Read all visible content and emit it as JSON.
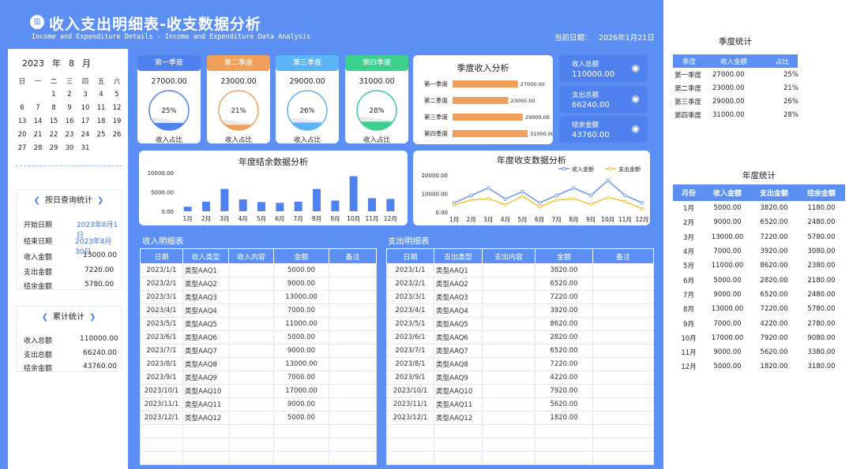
{
  "header": {
    "icon": "chart-badge-icon",
    "title": "收入支出明细表-收支数据分析",
    "subtitle": "Income and Expenditure Details - Income and Expenditure Data Analysis",
    "date_label": "当前日期：",
    "date_value": "2026年1月21日"
  },
  "calendar": {
    "year": "2023",
    "year_unit": "年",
    "month": "8",
    "month_unit": "月",
    "weekdays": [
      "日",
      "一",
      "二",
      "三",
      "四",
      "五",
      "六"
    ],
    "weeks": [
      [
        "",
        "",
        "1",
        "2",
        "3",
        "4",
        "5"
      ],
      [
        "6",
        "7",
        "8",
        "9",
        "10",
        "11",
        "12"
      ],
      [
        "13",
        "14",
        "15",
        "16",
        "17",
        "18",
        "19"
      ],
      [
        "20",
        "21",
        "22",
        "23",
        "24",
        "25",
        "26"
      ],
      [
        "27",
        "28",
        "29",
        "30",
        "31",
        "",
        ""
      ]
    ]
  },
  "daily_query": {
    "title": "按日查询统计",
    "start_label": "开始日期",
    "start_value": "2023年8月1日",
    "end_label": "结束日期",
    "end_value": "2023年8月30日",
    "income_label": "收入金额",
    "income_value": "13000.00",
    "expense_label": "支出金额",
    "expense_value": "7220.00",
    "balance_label": "结余金额",
    "balance_value": "5780.00"
  },
  "cumulative": {
    "title": "累计统计",
    "income_label": "收入总额",
    "income_value": "110000.00",
    "expense_label": "支出总额",
    "expense_value": "66240.00",
    "balance_label": "结余金额",
    "balance_value": "43760.00"
  },
  "quarter_cards": [
    {
      "label": "第一季度",
      "value": "27000.00",
      "percent": "25%",
      "ratio": 0.25,
      "color": "#4f82ee",
      "caption": "收入占比"
    },
    {
      "label": "第二季度",
      "value": "23000.00",
      "percent": "21%",
      "ratio": 0.21,
      "color": "#f0a05a",
      "caption": "收入占比"
    },
    {
      "label": "第三季度",
      "value": "29000.00",
      "percent": "26%",
      "ratio": 0.26,
      "color": "#5ab4f5",
      "caption": "收入占比"
    },
    {
      "label": "第四季度",
      "value": "31000.00",
      "percent": "28%",
      "ratio": 0.28,
      "color": "#3dcf8e",
      "caption": "收入占比"
    }
  ],
  "summary_cards": [
    {
      "label": "收入总额",
      "value": "110000.00",
      "icon": "piggy-bank-icon"
    },
    {
      "label": "支出总额",
      "value": "66240.00",
      "icon": "hand-coin-icon"
    },
    {
      "label": "结余金额",
      "value": "43760.00",
      "icon": "cash-icon"
    }
  ],
  "colors": {
    "brand": "#5b8ff4",
    "bar": "#4f82ee",
    "orange": "#f0a05a",
    "line_income": "#6f9cf2",
    "line_expense": "#f2c53d"
  },
  "chart_data": [
    {
      "type": "bar",
      "title": "季度收入分析",
      "orientation": "horizontal",
      "categories": [
        "第一季度",
        "第二季度",
        "第三季度",
        "第四季度"
      ],
      "values": [
        27000,
        23000,
        29000,
        31000
      ],
      "value_labels": [
        "27000.00",
        "23000.00",
        "29000.00",
        "31000.00"
      ]
    },
    {
      "type": "bar",
      "title": "年度结余数据分析",
      "categories": [
        "1月",
        "2月",
        "3月",
        "4月",
        "5月",
        "6月",
        "7月",
        "8月",
        "9月",
        "10月",
        "11月",
        "12月"
      ],
      "values": [
        1180,
        2480,
        5780,
        3080,
        2380,
        2180,
        2480,
        5780,
        2780,
        9080,
        3380,
        3180
      ],
      "y_ticks": [
        "10000.00",
        "5000.00",
        "0.00"
      ],
      "ylim": [
        0,
        10000
      ]
    },
    {
      "type": "line",
      "title": "年度收支数据分析",
      "categories": [
        "1月",
        "2月",
        "3月",
        "4月",
        "5月",
        "6月",
        "7月",
        "8月",
        "9月",
        "10月",
        "11月",
        "12月"
      ],
      "series": [
        {
          "name": "收入金额",
          "values": [
            5000,
            9000,
            13000,
            7000,
            11000,
            5000,
            9000,
            13000,
            9000,
            17000,
            9000,
            5000
          ]
        },
        {
          "name": "支出金额",
          "values": [
            3820,
            6520,
            7220,
            3920,
            8620,
            2820,
            6520,
            7220,
            4220,
            7920,
            5620,
            1820
          ]
        }
      ],
      "y_ticks": [
        "20000.00",
        "10000.00",
        "0.00"
      ],
      "ylim": [
        0,
        20000
      ],
      "legend": "top-right"
    }
  ],
  "income_table": {
    "title": "收入明细表",
    "headers": [
      "日期",
      "收入类型",
      "收入内容",
      "金额",
      "备注"
    ],
    "rows": [
      [
        "2023/1/1",
        "类型AAQ1",
        "",
        "5000.00",
        ""
      ],
      [
        "2023/2/1",
        "类型AAQ2",
        "",
        "9000.00",
        ""
      ],
      [
        "2023/3/1",
        "类型AAQ3",
        "",
        "13000.00",
        ""
      ],
      [
        "2023/4/1",
        "类型AAQ4",
        "",
        "7000.00",
        ""
      ],
      [
        "2023/5/1",
        "类型AAQ5",
        "",
        "11000.00",
        ""
      ],
      [
        "2023/6/1",
        "类型AAQ6",
        "",
        "5000.00",
        ""
      ],
      [
        "2023/7/1",
        "类型AAQ7",
        "",
        "9000.00",
        ""
      ],
      [
        "2023/8/1",
        "类型AAQ8",
        "",
        "13000.00",
        ""
      ],
      [
        "2023/9/1",
        "类型AAQ9",
        "",
        "7000.00",
        ""
      ],
      [
        "2023/10/1",
        "类型AAQ10",
        "",
        "17000.00",
        ""
      ],
      [
        "2023/11/1",
        "类型AAQ11",
        "",
        "9000.00",
        ""
      ],
      [
        "2023/12/1",
        "类型AAQ12",
        "",
        "5000.00",
        ""
      ],
      [
        "",
        "",
        "",
        "",
        ""
      ],
      [
        "",
        "",
        "",
        "",
        ""
      ],
      [
        "",
        "",
        "",
        "",
        ""
      ]
    ]
  },
  "expense_table": {
    "title": "支出明细表",
    "headers": [
      "日期",
      "支出类型",
      "支出内容",
      "金额",
      "备注"
    ],
    "rows": [
      [
        "2023/1/1",
        "类型AAQ1",
        "",
        "3820.00",
        ""
      ],
      [
        "2023/2/1",
        "类型AAQ2",
        "",
        "6520.00",
        ""
      ],
      [
        "2023/3/1",
        "类型AAQ3",
        "",
        "7220.00",
        ""
      ],
      [
        "2023/4/1",
        "类型AAQ4",
        "",
        "3920.00",
        ""
      ],
      [
        "2023/5/1",
        "类型AAQ5",
        "",
        "8620.00",
        ""
      ],
      [
        "2023/6/1",
        "类型AAQ6",
        "",
        "2820.00",
        ""
      ],
      [
        "2023/7/1",
        "类型AAQ7",
        "",
        "6520.00",
        ""
      ],
      [
        "2023/8/1",
        "类型AAQ8",
        "",
        "7220.00",
        ""
      ],
      [
        "2023/9/1",
        "类型AAQ9",
        "",
        "4220.00",
        ""
      ],
      [
        "2023/10/1",
        "类型AAQ10",
        "",
        "7920.00",
        ""
      ],
      [
        "2023/11/1",
        "类型AAQ11",
        "",
        "5620.00",
        ""
      ],
      [
        "2023/12/1",
        "类型AAQ12",
        "",
        "1820.00",
        ""
      ],
      [
        "",
        "",
        "",
        "",
        ""
      ],
      [
        "",
        "",
        "",
        "",
        ""
      ],
      [
        "",
        "",
        "",
        "",
        ""
      ]
    ]
  },
  "quarter_stats": {
    "title": "季度统计",
    "headers": [
      "季度",
      "收入金额",
      "占比"
    ],
    "rows": [
      [
        "第一季度",
        "27000.00",
        "25%"
      ],
      [
        "第二季度",
        "23000.00",
        "21%"
      ],
      [
        "第三季度",
        "29000.00",
        "26%"
      ],
      [
        "第四季度",
        "31000.00",
        "28%"
      ]
    ]
  },
  "year_stats": {
    "title": "年度统计",
    "headers": [
      "月份",
      "收入金额",
      "支出金额",
      "结余金额"
    ],
    "rows": [
      [
        "1月",
        "5000.00",
        "3820.00",
        "1180.00"
      ],
      [
        "2月",
        "9000.00",
        "6520.00",
        "2480.00"
      ],
      [
        "3月",
        "13000.00",
        "7220.00",
        "5780.00"
      ],
      [
        "4月",
        "7000.00",
        "3920.00",
        "3080.00"
      ],
      [
        "5月",
        "11000.00",
        "8620.00",
        "2380.00"
      ],
      [
        "6月",
        "5000.00",
        "2820.00",
        "2180.00"
      ],
      [
        "7月",
        "9000.00",
        "6520.00",
        "2480.00"
      ],
      [
        "8月",
        "13000.00",
        "7220.00",
        "5780.00"
      ],
      [
        "9月",
        "7000.00",
        "4220.00",
        "2780.00"
      ],
      [
        "10月",
        "17000.00",
        "7920.00",
        "9080.00"
      ],
      [
        "11月",
        "9000.00",
        "5620.00",
        "3380.00"
      ],
      [
        "12月",
        "5000.00",
        "1820.00",
        "3180.00"
      ]
    ]
  }
}
